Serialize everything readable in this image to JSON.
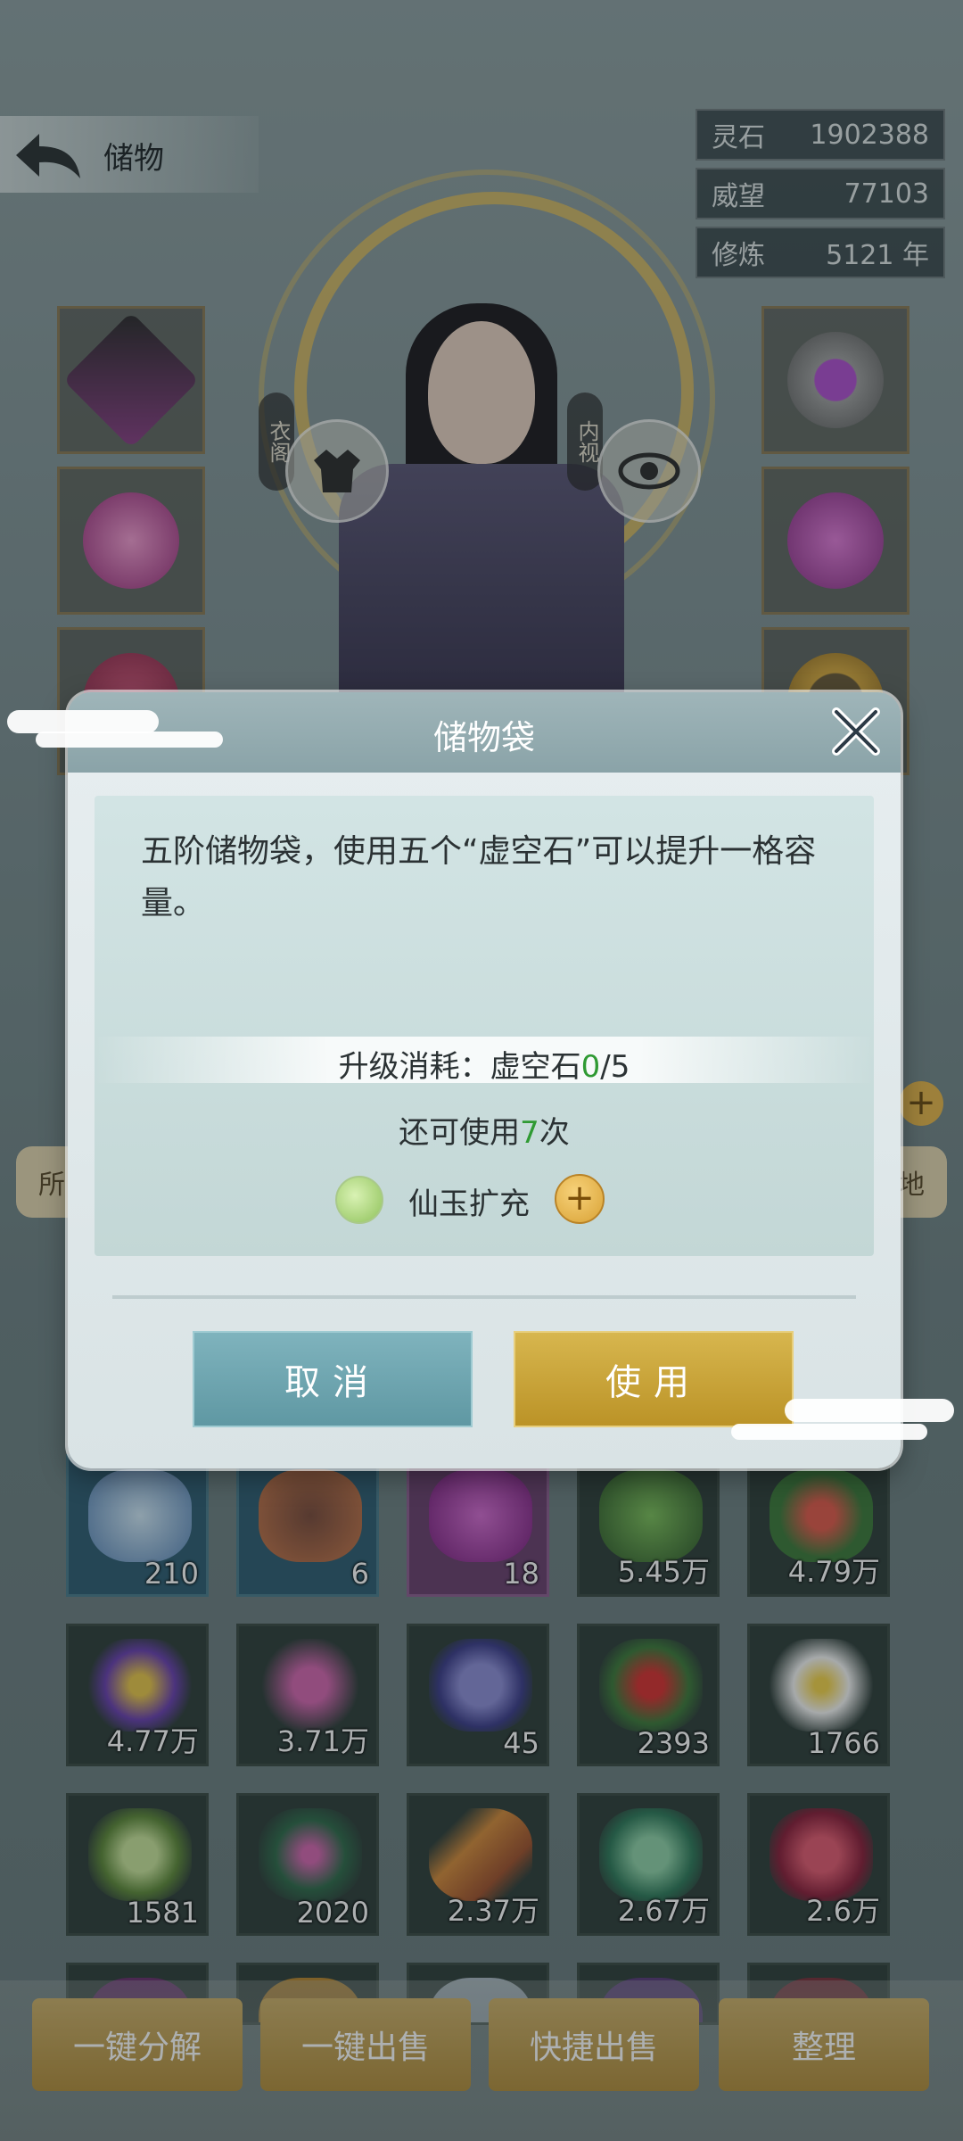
{
  "header": {
    "title": "储物"
  },
  "stats": [
    {
      "label": "灵石",
      "value": "1902388"
    },
    {
      "label": "威望",
      "value": "77103"
    },
    {
      "label": "修炼",
      "value": "5121 年"
    }
  ],
  "character": {
    "left_label": "衣阁",
    "right_label": "内视"
  },
  "side_tabs": {
    "left": "所",
    "right": "地"
  },
  "dialog": {
    "title": "储物袋",
    "description": "五阶储物袋，使用五个“虚空石”可以提升一格容量。",
    "cost_label": "升级消耗：虚空石",
    "cost_current": "0",
    "cost_total": "/5",
    "remain_prefix": "还可使用",
    "remain_count": "7",
    "remain_suffix": "次",
    "expand_label": "仙玉扩充",
    "cancel_label": "取消",
    "use_label": "使用"
  },
  "inventory": {
    "row1": [
      "210",
      "6",
      "18",
      "5.45万",
      "4.79万"
    ],
    "row2": [
      "4.77万",
      "3.71万",
      "45",
      "2393",
      "1766"
    ],
    "row3": [
      "1581",
      "2020",
      "2.37万",
      "2.67万",
      "2.6万"
    ]
  },
  "bottom_buttons": [
    "一键分解",
    "一键出售",
    "快捷出售",
    "整理"
  ],
  "colors": {
    "accent_gold": "#c9a53f",
    "cancel_teal": "#6ea6b0",
    "highlight_green": "#2f9a33"
  }
}
